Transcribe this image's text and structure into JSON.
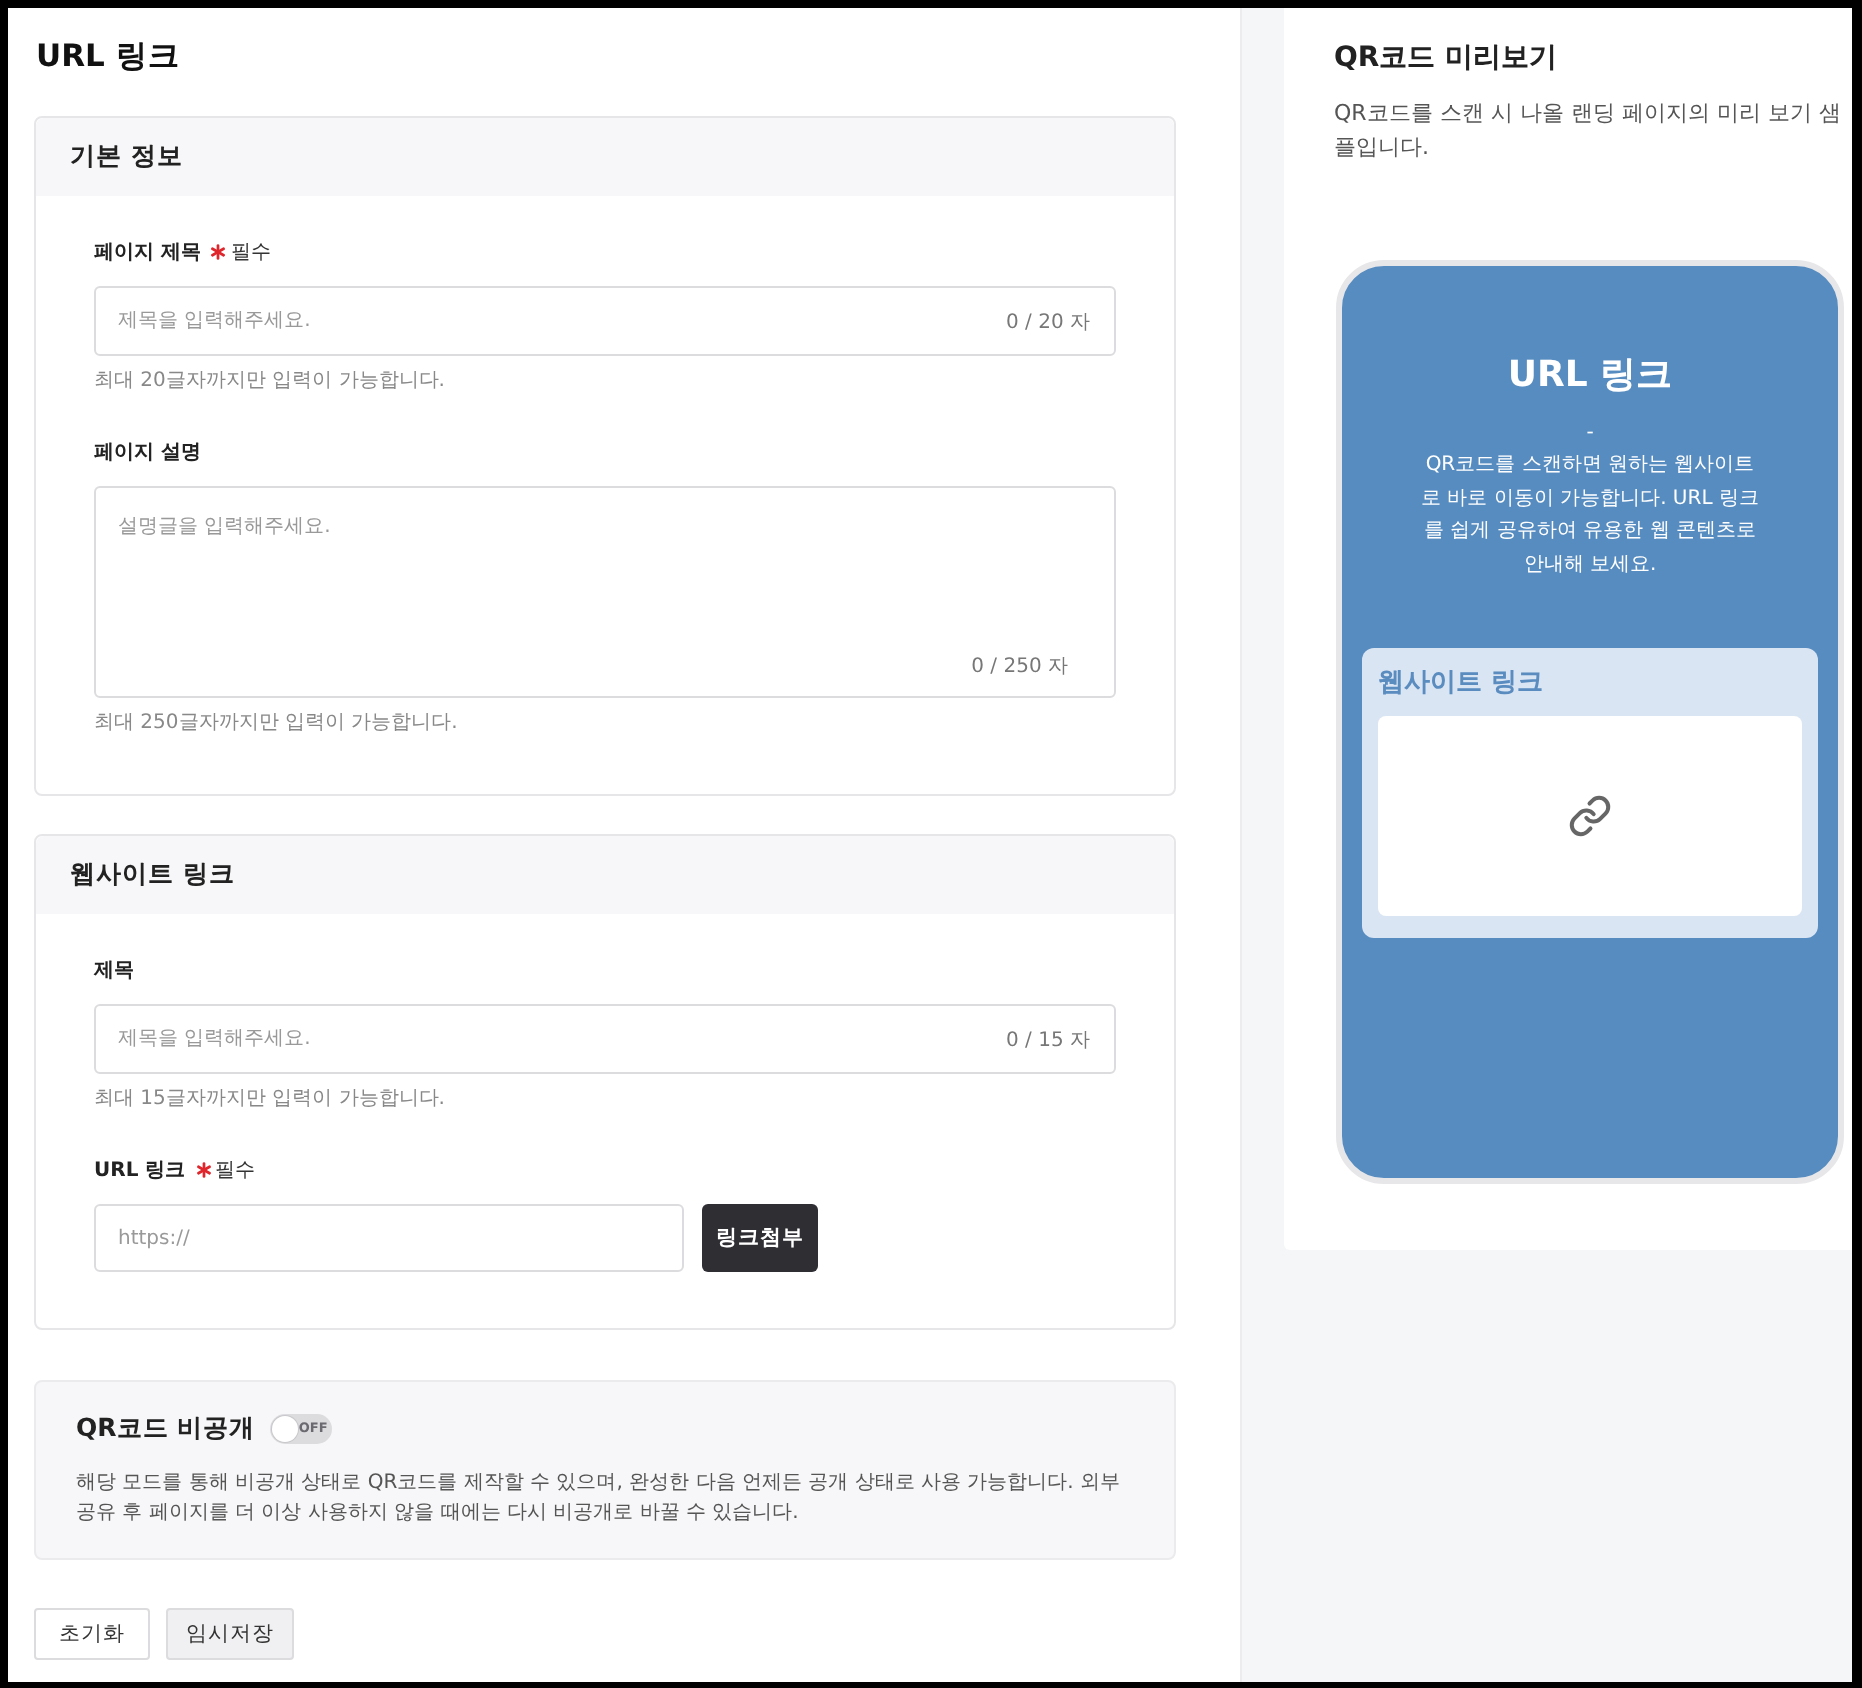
{
  "page_title": "URL 링크",
  "sections": [
    {
      "title": "기본 정보",
      "fields": [
        {
          "kind": "input",
          "label": "페이지 제목",
          "required": true,
          "required_text": "필수",
          "placeholder": "제목을 입력해주세요.",
          "counter": "0 / 20 자",
          "help": "최대 20글자까지만 입력이 가능합니다."
        },
        {
          "kind": "textarea",
          "label": "페이지 설명",
          "required": false,
          "placeholder": "설명글을 입력해주세요.",
          "counter": "0 / 250 자",
          "help": "최대 250글자까지만 입력이 가능합니다."
        }
      ]
    },
    {
      "title": "웹사이트 링크",
      "fields": [
        {
          "kind": "input",
          "label": "제목",
          "required": false,
          "placeholder": "제목을 입력해주세요.",
          "counter": "0 / 15 자",
          "help": "최대 15글자까지만 입력이 가능합니다."
        },
        {
          "kind": "url",
          "label": "URL 링크",
          "required": true,
          "required_text": "필수",
          "placeholder": "https://",
          "button": "링크첨부"
        }
      ]
    }
  ],
  "private_option": {
    "title": "QR코드 비공개",
    "toggle": {
      "on": false,
      "label": "OFF"
    },
    "description": "해당 모드를 통해 비공개 상태로 QR코드를 제작할 수 있으며, 완성한 다음 언제든 공개 상태로 사용 가능합니다. 외부 공유 후 페이지를 더 이상 사용하지 않을 때에는 다시 비공개로 바꿀 수 있습니다."
  },
  "actions": [
    {
      "kind": "outline",
      "label": "초기화"
    },
    {
      "kind": "filled",
      "label": "임시저장"
    }
  ],
  "preview": {
    "title": "QR코드 미리보기",
    "description": "QR코드를 스캔 시 나올 랜딩 페이지의 미리 보기 샘플입니다.",
    "phone": {
      "title": "URL 링크",
      "separator": "-",
      "description": "QR코드를 스캔하면 원하는 웹사이트로 바로 이동이 가능합니다. URL 링크를 쉽게 공유하여 유용한 웹 콘텐츠로 안내해 보세요.",
      "link_card": {
        "title": "웹사이트 링크"
      }
    }
  }
}
